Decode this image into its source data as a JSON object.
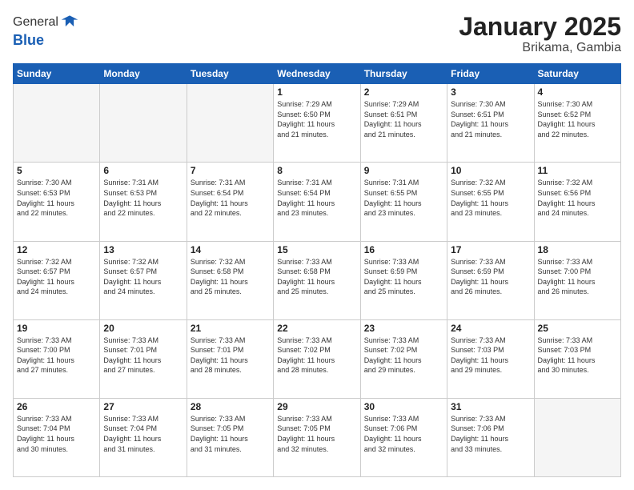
{
  "header": {
    "logo_line1": "General",
    "logo_line2": "Blue",
    "title": "January 2025",
    "subtitle": "Brikama, Gambia"
  },
  "weekdays": [
    "Sunday",
    "Monday",
    "Tuesday",
    "Wednesday",
    "Thursday",
    "Friday",
    "Saturday"
  ],
  "weeks": [
    [
      {
        "day": "",
        "info": ""
      },
      {
        "day": "",
        "info": ""
      },
      {
        "day": "",
        "info": ""
      },
      {
        "day": "1",
        "info": "Sunrise: 7:29 AM\nSunset: 6:50 PM\nDaylight: 11 hours\nand 21 minutes."
      },
      {
        "day": "2",
        "info": "Sunrise: 7:29 AM\nSunset: 6:51 PM\nDaylight: 11 hours\nand 21 minutes."
      },
      {
        "day": "3",
        "info": "Sunrise: 7:30 AM\nSunset: 6:51 PM\nDaylight: 11 hours\nand 21 minutes."
      },
      {
        "day": "4",
        "info": "Sunrise: 7:30 AM\nSunset: 6:52 PM\nDaylight: 11 hours\nand 22 minutes."
      }
    ],
    [
      {
        "day": "5",
        "info": "Sunrise: 7:30 AM\nSunset: 6:53 PM\nDaylight: 11 hours\nand 22 minutes."
      },
      {
        "day": "6",
        "info": "Sunrise: 7:31 AM\nSunset: 6:53 PM\nDaylight: 11 hours\nand 22 minutes."
      },
      {
        "day": "7",
        "info": "Sunrise: 7:31 AM\nSunset: 6:54 PM\nDaylight: 11 hours\nand 22 minutes."
      },
      {
        "day": "8",
        "info": "Sunrise: 7:31 AM\nSunset: 6:54 PM\nDaylight: 11 hours\nand 23 minutes."
      },
      {
        "day": "9",
        "info": "Sunrise: 7:31 AM\nSunset: 6:55 PM\nDaylight: 11 hours\nand 23 minutes."
      },
      {
        "day": "10",
        "info": "Sunrise: 7:32 AM\nSunset: 6:55 PM\nDaylight: 11 hours\nand 23 minutes."
      },
      {
        "day": "11",
        "info": "Sunrise: 7:32 AM\nSunset: 6:56 PM\nDaylight: 11 hours\nand 24 minutes."
      }
    ],
    [
      {
        "day": "12",
        "info": "Sunrise: 7:32 AM\nSunset: 6:57 PM\nDaylight: 11 hours\nand 24 minutes."
      },
      {
        "day": "13",
        "info": "Sunrise: 7:32 AM\nSunset: 6:57 PM\nDaylight: 11 hours\nand 24 minutes."
      },
      {
        "day": "14",
        "info": "Sunrise: 7:32 AM\nSunset: 6:58 PM\nDaylight: 11 hours\nand 25 minutes."
      },
      {
        "day": "15",
        "info": "Sunrise: 7:33 AM\nSunset: 6:58 PM\nDaylight: 11 hours\nand 25 minutes."
      },
      {
        "day": "16",
        "info": "Sunrise: 7:33 AM\nSunset: 6:59 PM\nDaylight: 11 hours\nand 25 minutes."
      },
      {
        "day": "17",
        "info": "Sunrise: 7:33 AM\nSunset: 6:59 PM\nDaylight: 11 hours\nand 26 minutes."
      },
      {
        "day": "18",
        "info": "Sunrise: 7:33 AM\nSunset: 7:00 PM\nDaylight: 11 hours\nand 26 minutes."
      }
    ],
    [
      {
        "day": "19",
        "info": "Sunrise: 7:33 AM\nSunset: 7:00 PM\nDaylight: 11 hours\nand 27 minutes."
      },
      {
        "day": "20",
        "info": "Sunrise: 7:33 AM\nSunset: 7:01 PM\nDaylight: 11 hours\nand 27 minutes."
      },
      {
        "day": "21",
        "info": "Sunrise: 7:33 AM\nSunset: 7:01 PM\nDaylight: 11 hours\nand 28 minutes."
      },
      {
        "day": "22",
        "info": "Sunrise: 7:33 AM\nSunset: 7:02 PM\nDaylight: 11 hours\nand 28 minutes."
      },
      {
        "day": "23",
        "info": "Sunrise: 7:33 AM\nSunset: 7:02 PM\nDaylight: 11 hours\nand 29 minutes."
      },
      {
        "day": "24",
        "info": "Sunrise: 7:33 AM\nSunset: 7:03 PM\nDaylight: 11 hours\nand 29 minutes."
      },
      {
        "day": "25",
        "info": "Sunrise: 7:33 AM\nSunset: 7:03 PM\nDaylight: 11 hours\nand 30 minutes."
      }
    ],
    [
      {
        "day": "26",
        "info": "Sunrise: 7:33 AM\nSunset: 7:04 PM\nDaylight: 11 hours\nand 30 minutes."
      },
      {
        "day": "27",
        "info": "Sunrise: 7:33 AM\nSunset: 7:04 PM\nDaylight: 11 hours\nand 31 minutes."
      },
      {
        "day": "28",
        "info": "Sunrise: 7:33 AM\nSunset: 7:05 PM\nDaylight: 11 hours\nand 31 minutes."
      },
      {
        "day": "29",
        "info": "Sunrise: 7:33 AM\nSunset: 7:05 PM\nDaylight: 11 hours\nand 32 minutes."
      },
      {
        "day": "30",
        "info": "Sunrise: 7:33 AM\nSunset: 7:06 PM\nDaylight: 11 hours\nand 32 minutes."
      },
      {
        "day": "31",
        "info": "Sunrise: 7:33 AM\nSunset: 7:06 PM\nDaylight: 11 hours\nand 33 minutes."
      },
      {
        "day": "",
        "info": ""
      }
    ]
  ]
}
